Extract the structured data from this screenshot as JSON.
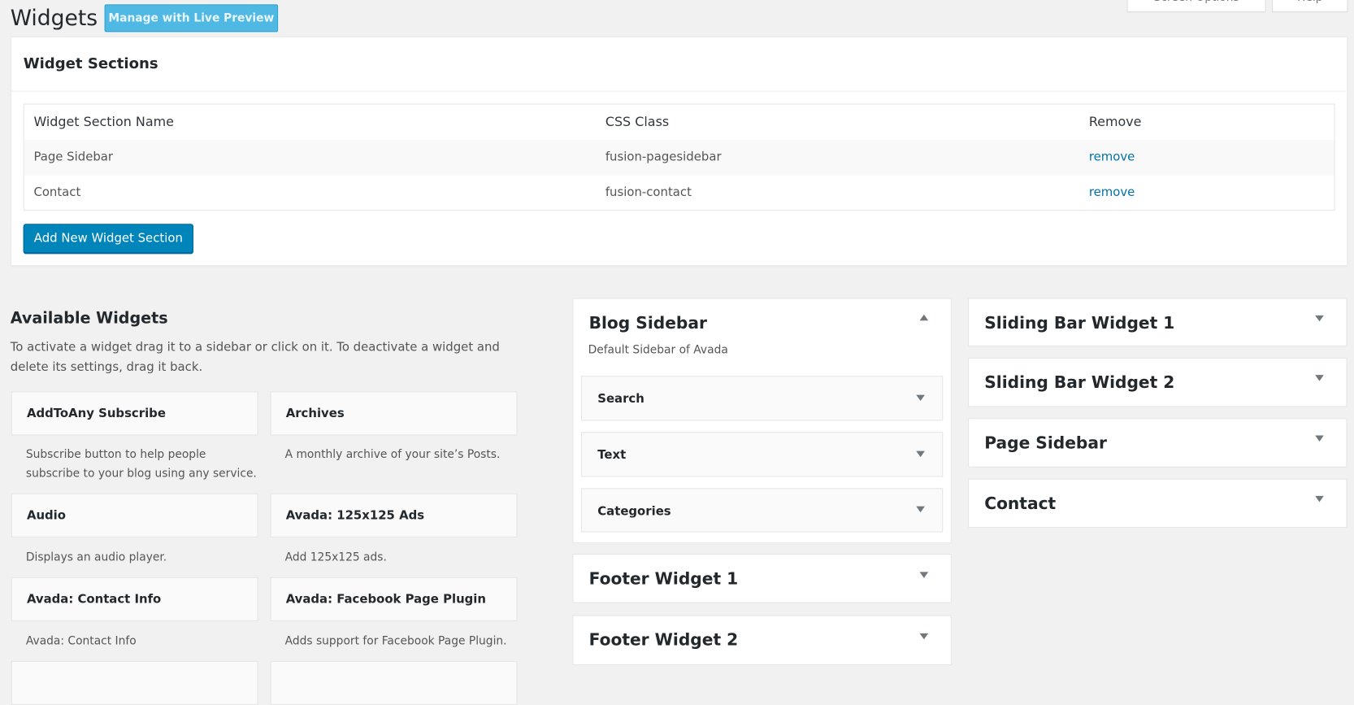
{
  "header": {
    "title": "Widgets",
    "live_preview": "Manage with Live Preview",
    "screen_options": "Screen Options",
    "help": "Help"
  },
  "widget_sections": {
    "title": "Widget Sections",
    "columns": [
      "Widget Section Name",
      "CSS Class",
      "Remove"
    ],
    "rows": [
      {
        "name": "Page Sidebar",
        "css": "fusion-pagesidebar",
        "action": "remove"
      },
      {
        "name": "Contact",
        "css": "fusion-contact",
        "action": "remove"
      }
    ],
    "add_button": "Add New Widget Section"
  },
  "available": {
    "title": "Available Widgets",
    "description": "To activate a widget drag it to a sidebar or click on it. To deactivate a widget and delete its settings, drag it back.",
    "widgets": [
      {
        "name": "AddToAny Subscribe",
        "desc": "Subscribe button to help people subscribe to your blog using any service."
      },
      {
        "name": "Archives",
        "desc": "A monthly archive of your site’s Posts."
      },
      {
        "name": "Audio",
        "desc": "Displays an audio player."
      },
      {
        "name": "Avada: 125x125 Ads",
        "desc": "Add 125x125 ads."
      },
      {
        "name": "Avada: Contact Info",
        "desc": "Avada: Contact Info"
      },
      {
        "name": "Avada: Facebook Page Plugin",
        "desc": "Adds support for Facebook Page Plugin."
      }
    ]
  },
  "blog_sidebar": {
    "title": "Blog Sidebar",
    "desc": "Default Sidebar of Avada",
    "widgets": [
      "Search",
      "Text",
      "Categories"
    ]
  },
  "sidebars_mid": [
    "Footer Widget 1",
    "Footer Widget 2"
  ],
  "sidebars_right": [
    "Sliding Bar Widget 1",
    "Sliding Bar Widget 2",
    "Page Sidebar",
    "Contact"
  ]
}
